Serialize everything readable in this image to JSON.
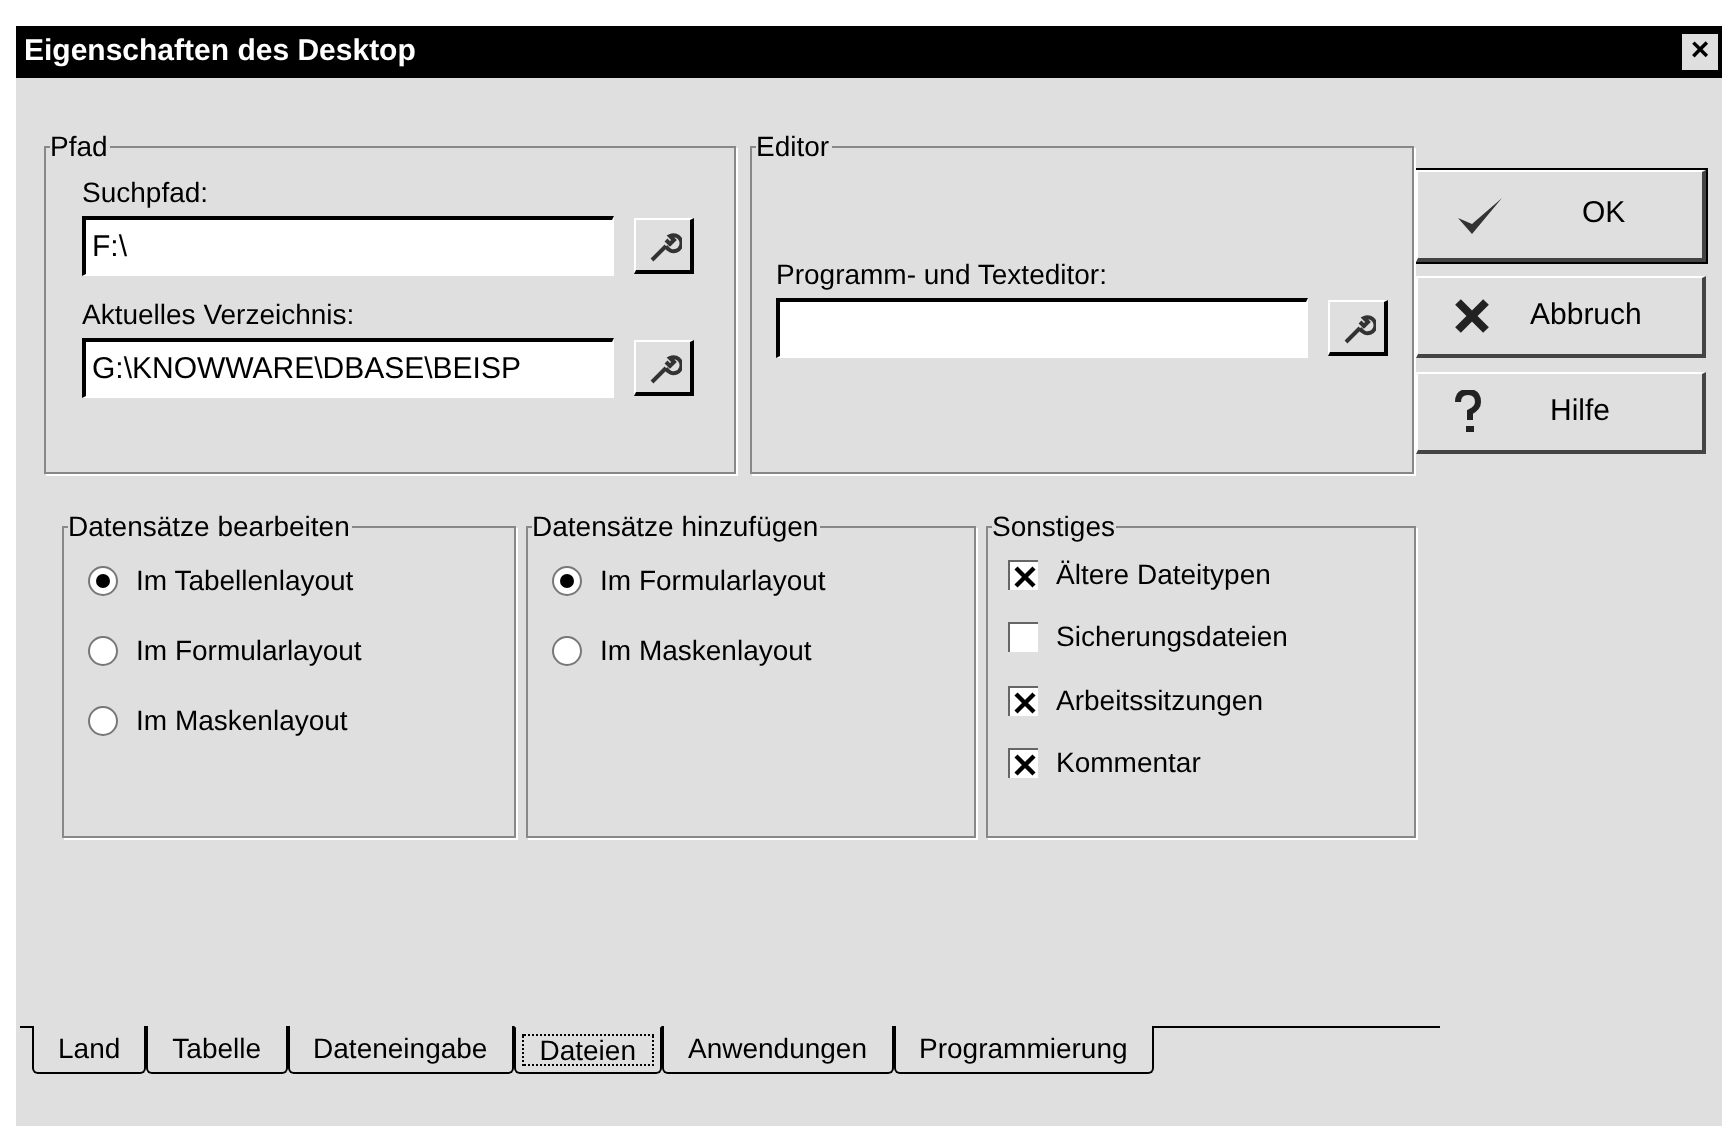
{
  "window": {
    "title": "Eigenschaften des Desktop",
    "close": "×"
  },
  "pfad": {
    "title": "Pfad",
    "fields": [
      {
        "label": "Suchpfad:",
        "value": "F:\\"
      },
      {
        "label": "Aktuelles Verzeichnis:",
        "value": "G:\\KNOWWARE\\DBASE\\BEISP"
      }
    ]
  },
  "editor": {
    "title": "Editor",
    "fields": [
      {
        "label": "Programm- und Texteditor:"
      }
    ]
  },
  "buttons": [
    {
      "kind": "ok",
      "label": "OK"
    },
    {
      "kind": "cancel",
      "label": "Abbruch"
    },
    {
      "kind": "help",
      "label": "Hilfe"
    }
  ],
  "bearbeiten": {
    "title": "Datensätze bearbeiten",
    "options": [
      {
        "label": "Im Tabellenlayout",
        "selected": true
      },
      {
        "label": "Im Formularlayout",
        "selected": false
      },
      {
        "label": "Im Maskenlayout",
        "selected": false
      }
    ]
  },
  "hinzufuegen": {
    "title": "Datensätze hinzufügen",
    "options": [
      {
        "label": "Im Formularlayout",
        "selected": true
      },
      {
        "label": "Im Maskenlayout",
        "selected": false
      }
    ]
  },
  "sonstiges": {
    "title": "Sonstiges",
    "options": [
      {
        "label": "Ältere Dateitypen",
        "checked": true
      },
      {
        "label": "Sicherungsdateien",
        "checked": false
      },
      {
        "label": "Arbeitssitzungen",
        "checked": true
      },
      {
        "label": "Kommentar",
        "checked": true
      }
    ]
  },
  "tabs": [
    {
      "label": "Land",
      "selected": false
    },
    {
      "label": "Tabelle",
      "selected": false
    },
    {
      "label": "Dateneingabe",
      "selected": false
    },
    {
      "label": "Dateien",
      "selected": true
    },
    {
      "label": "Anwendungen",
      "selected": false
    },
    {
      "label": "Programmierung",
      "selected": false
    }
  ]
}
